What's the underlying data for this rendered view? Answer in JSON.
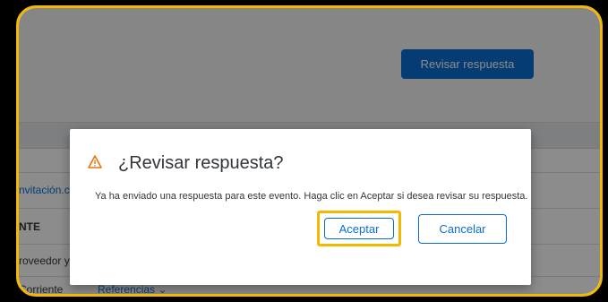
{
  "header": {
    "review_button": "Revisar respuesta"
  },
  "table": {
    "rows": [
      "nvitación.c",
      "NTE",
      "roveedor y",
      "Corriente",
      "Referencias ⌄"
    ]
  },
  "dialog": {
    "title": "¿Revisar respuesta?",
    "message": "Ya ha enviado una respuesta para este evento. Haga clic en Aceptar si desea revisar su respuesta.",
    "accept": "Aceptar",
    "cancel": "Cancelar"
  },
  "colors": {
    "highlight": "#f5b800",
    "accent": "#0a6ed1",
    "warning": "#e9730c"
  }
}
